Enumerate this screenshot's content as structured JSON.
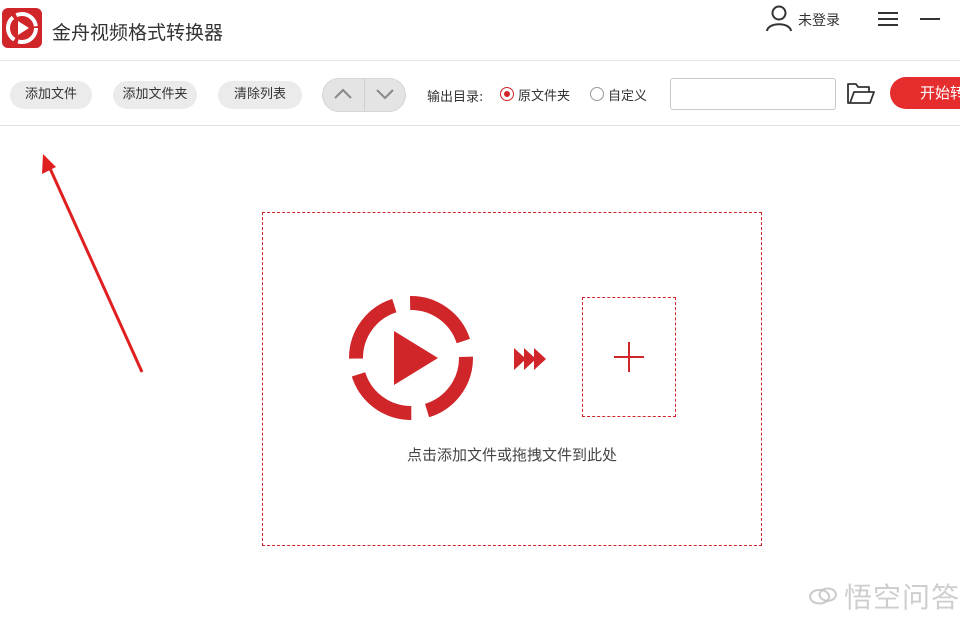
{
  "app": {
    "title": "金舟视频格式转换器",
    "user_label": "未登录"
  },
  "toolbar": {
    "add_file": "添加文件",
    "add_folder": "添加文件夹",
    "clear_list": "清除列表",
    "output_dir_label": "输出目录:",
    "radio_original": "原文件夹",
    "radio_custom": "自定义",
    "selected_output": "原文件夹",
    "path_value": "",
    "path_placeholder": "",
    "start_label": "开始转换"
  },
  "dropzone": {
    "hint": "点击添加文件或拖拽文件到此处"
  },
  "icons": {
    "logo": "play-logo-icon",
    "user": "user-icon",
    "menu": "hamburger-menu-icon",
    "minimize": "minimize-icon",
    "up": "chevron-up-icon",
    "down": "chevron-down-icon",
    "folder": "folder-open-icon",
    "plus": "plus-icon",
    "arrows": "triple-arrow-icon",
    "annotation": "red-arrow-annotation-icon"
  },
  "colors": {
    "brand_red": "#d0262a",
    "start_button": "#e52d2d",
    "button_gray": "#ebebeb"
  },
  "watermark": {
    "text": "悟空问答"
  }
}
